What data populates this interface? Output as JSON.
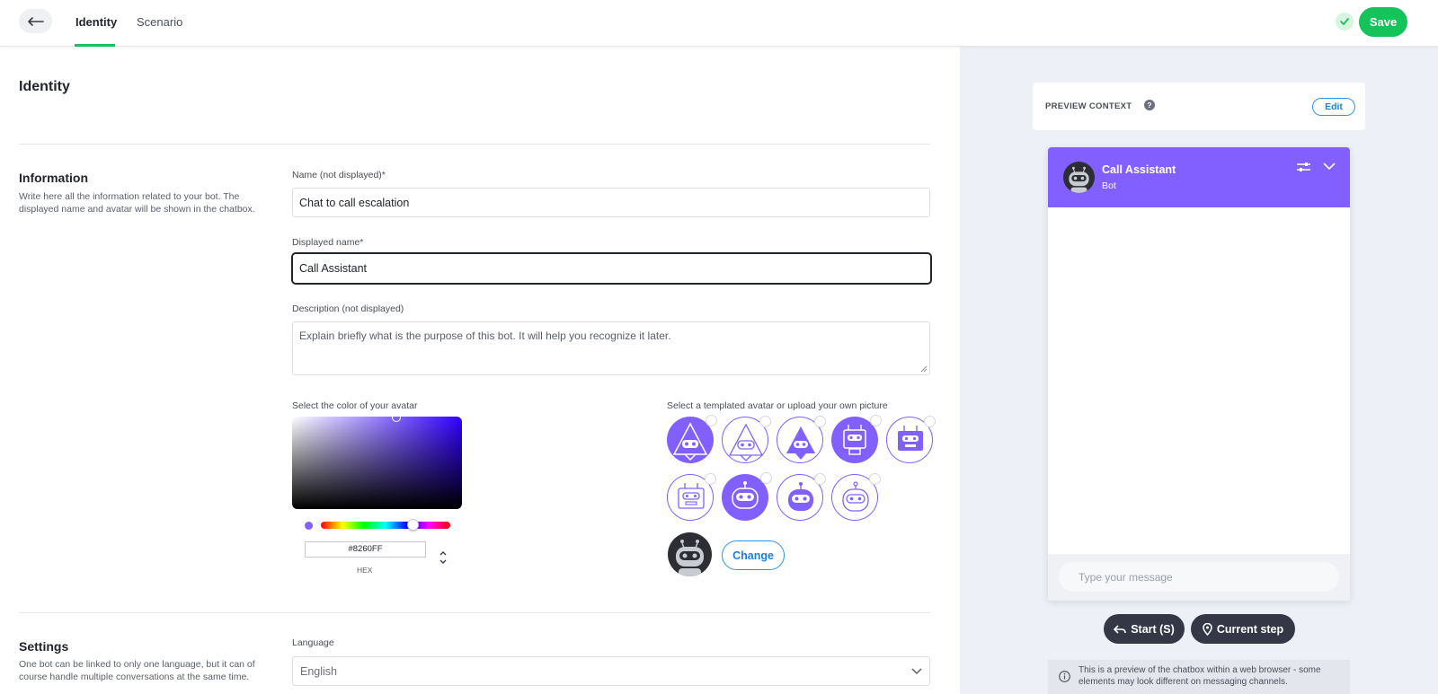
{
  "header": {
    "tabs": [
      {
        "label": "Identity",
        "active": true
      },
      {
        "label": "Scenario",
        "active": false
      }
    ],
    "save_label": "Save",
    "accent_color": "#14c35a"
  },
  "form": {
    "page_title": "Identity",
    "information": {
      "title": "Information",
      "description": "Write here all the information related to your bot. The displayed name and avatar will be shown in the chatbox.",
      "name_label": "Name (not displayed)*",
      "name_value": "Chat to call escalation",
      "displayed_name_label": "Displayed name*",
      "displayed_name_value": "Call Assistant",
      "description_label": "Description (not displayed)",
      "description_placeholder": "Explain briefly what is the purpose of this bot. It will help you recognize it later.",
      "color_label": "Select the color of your avatar",
      "hex_value": "#8260FF",
      "hex_label": "HEX",
      "avatar_label": "Select a templated avatar or upload your own picture",
      "change_label": "Change"
    },
    "settings": {
      "title": "Settings",
      "description": "One bot can be linked to only one language, but it can of course handle multiple conversations at the same time.",
      "language_label": "Language",
      "language_value": "English"
    }
  },
  "preview": {
    "context_label": "PREVIEW CONTEXT",
    "help_glyph": "?",
    "edit_label": "Edit",
    "bot_name": "Call Assistant",
    "bot_role": "Bot",
    "input_placeholder": "Type your message",
    "start_label": "Start (S)",
    "current_step_label": "Current step",
    "info_text": "This is a preview of the chatbox within a web browser - some elements may look different on messaging channels.",
    "header_color": "#8260ff"
  }
}
